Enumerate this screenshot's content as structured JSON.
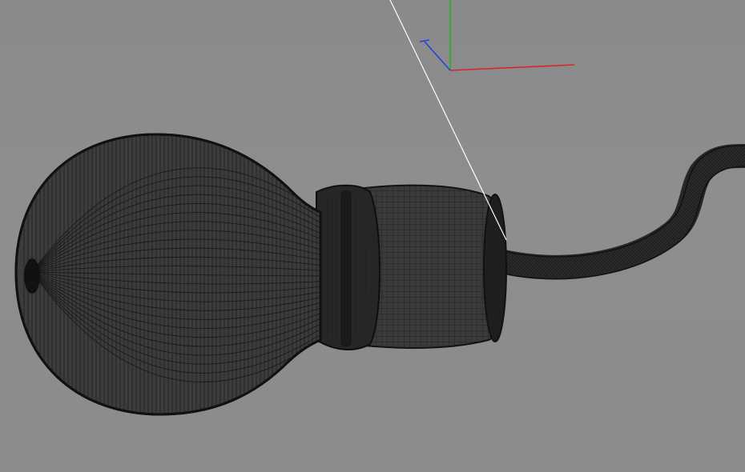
{
  "viewport": {
    "background": "#8c8c8c",
    "mesh_color": "#1a1a1a",
    "mesh_fill": "#3b3b3b"
  },
  "gizmo": {
    "x_axis_color": "#e02020",
    "y_axis_color": "#20b020",
    "z_axis_color": "#2040e0"
  },
  "light_line": {
    "color": "#ffffff"
  },
  "model": {
    "parts": [
      "bulb",
      "neck",
      "socket-ring",
      "socket-body",
      "cable"
    ]
  }
}
